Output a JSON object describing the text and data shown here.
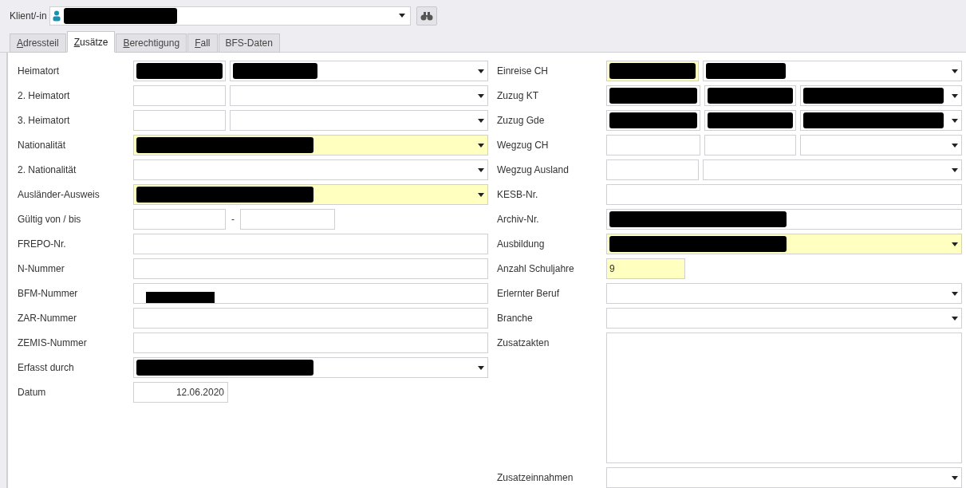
{
  "client": {
    "label": "Klient/-in",
    "redacted": true
  },
  "tabs": [
    {
      "label": "Adressteil",
      "selected": false,
      "mnemonic": true
    },
    {
      "label": "Zusätze",
      "selected": true,
      "mnemonic": true
    },
    {
      "label": "Berechtigung",
      "selected": false,
      "mnemonic": true
    },
    {
      "label": "Fall",
      "selected": false,
      "mnemonic": true
    },
    {
      "label": "BFS-Daten",
      "selected": false,
      "mnemonic": false
    }
  ],
  "left_fields": [
    {
      "label": "Heimatort",
      "kind": "split",
      "required": false,
      "redacted": true
    },
    {
      "label": "2. Heimatort",
      "kind": "split",
      "required": false,
      "redacted": false
    },
    {
      "label": "3. Heimatort",
      "kind": "split",
      "required": false,
      "redacted": false
    },
    {
      "label": "Nationalität",
      "kind": "combo",
      "required": true,
      "redacted": true
    },
    {
      "label": "2. Nationalität",
      "kind": "combo",
      "required": false,
      "redacted": false
    },
    {
      "label": "Ausländer-Ausweis",
      "kind": "combo",
      "required": true,
      "redacted": true
    },
    {
      "label": "Gültig von / bis",
      "kind": "range",
      "separator": "-",
      "required": false
    },
    {
      "label": "FREPO-Nr.",
      "kind": "text",
      "required": false,
      "redacted": false
    },
    {
      "label": "N-Nummer",
      "kind": "text",
      "required": false,
      "redacted": false
    },
    {
      "label": "BFM-Nummer",
      "kind": "text",
      "required": false,
      "redacted": true
    },
    {
      "label": "ZAR-Nummer",
      "kind": "text",
      "required": false,
      "redacted": false
    },
    {
      "label": "ZEMIS-Nummer",
      "kind": "text",
      "required": false,
      "redacted": false
    },
    {
      "label": "Erfasst durch",
      "kind": "combo",
      "required": false,
      "redacted": true
    },
    {
      "label": "Datum",
      "kind": "date",
      "value": "12.06.2020",
      "required": false
    }
  ],
  "right_fields": [
    {
      "label": "Einreise CH",
      "kind": "split",
      "required": true,
      "redacted": true
    },
    {
      "label": "Zuzug KT",
      "kind": "triple",
      "required": false,
      "redacted": true
    },
    {
      "label": "Zuzug Gde",
      "kind": "triple",
      "required": false,
      "redacted": true
    },
    {
      "label": "Wegzug CH",
      "kind": "triple",
      "required": false,
      "redacted": false
    },
    {
      "label": "Wegzug Ausland",
      "kind": "split",
      "required": false,
      "redacted": false
    },
    {
      "label": "KESB-Nr.",
      "kind": "text",
      "required": false,
      "redacted": false
    },
    {
      "label": "Archiv-Nr.",
      "kind": "text",
      "required": false,
      "redacted": true
    },
    {
      "label": "Ausbildung",
      "kind": "combo",
      "required": true,
      "redacted": true
    },
    {
      "label": "Anzahl Schuljahre",
      "kind": "short",
      "value": "9",
      "required": true
    },
    {
      "label": "Erlernter Beruf",
      "kind": "combo",
      "required": false,
      "redacted": false
    },
    {
      "label": "Branche",
      "kind": "combo",
      "required": false,
      "redacted": false
    },
    {
      "label": "Zusatzakten",
      "kind": "textarea",
      "required": false
    },
    {
      "label": "Zusatzeinnahmen",
      "kind": "combo",
      "required": false,
      "redacted": false
    }
  ]
}
